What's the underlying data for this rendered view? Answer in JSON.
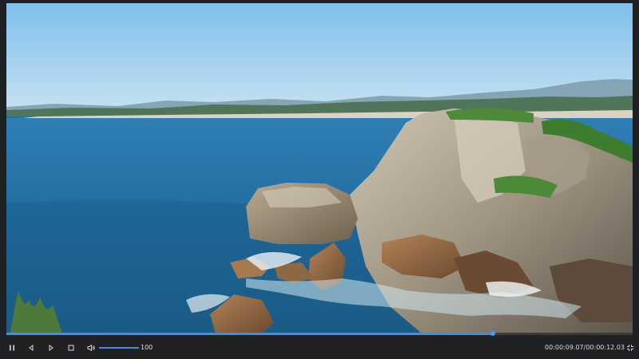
{
  "player": {
    "progress_fraction": 0.7765,
    "current_time": "00:00:09.07",
    "separator": "/",
    "total_time": "00:00:12.03",
    "volume_fraction": 1.0,
    "volume_value": "100",
    "accent_color": "#3c8ee9"
  },
  "icons": {
    "pause": "pause-icon",
    "previous": "previous-frame-icon",
    "next": "next-frame-icon",
    "stop": "stop-icon",
    "volume": "volume-icon",
    "fullscreen": "fullscreen-icon"
  }
}
